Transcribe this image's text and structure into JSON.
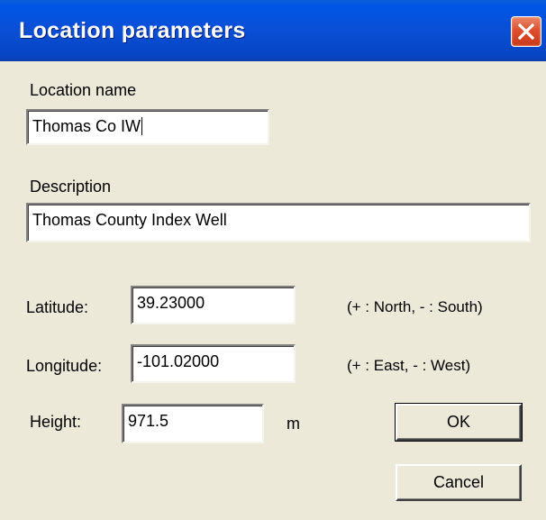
{
  "window": {
    "title": "Location parameters"
  },
  "form": {
    "location_name_label": "Location name",
    "location_name_value": "Thomas Co IW",
    "description_label": "Description",
    "description_value": "Thomas County Index Well",
    "latitude_label": "Latitude:",
    "latitude_value": "39.23000",
    "latitude_hint": "(+ : North, - : South)",
    "longitude_label": "Longitude:",
    "longitude_value": "-101.02000",
    "longitude_hint": "(+ : East, - : West)",
    "height_label": "Height:",
    "height_value": "971.5",
    "height_unit": "m"
  },
  "buttons": {
    "ok_label": "OK",
    "cancel_label": "Cancel"
  },
  "icons": {
    "close": "close-icon"
  },
  "colors": {
    "titlebar": "#0a4fd6",
    "dialog_background": "#ece9d8",
    "close_button": "#dd4f2e"
  }
}
